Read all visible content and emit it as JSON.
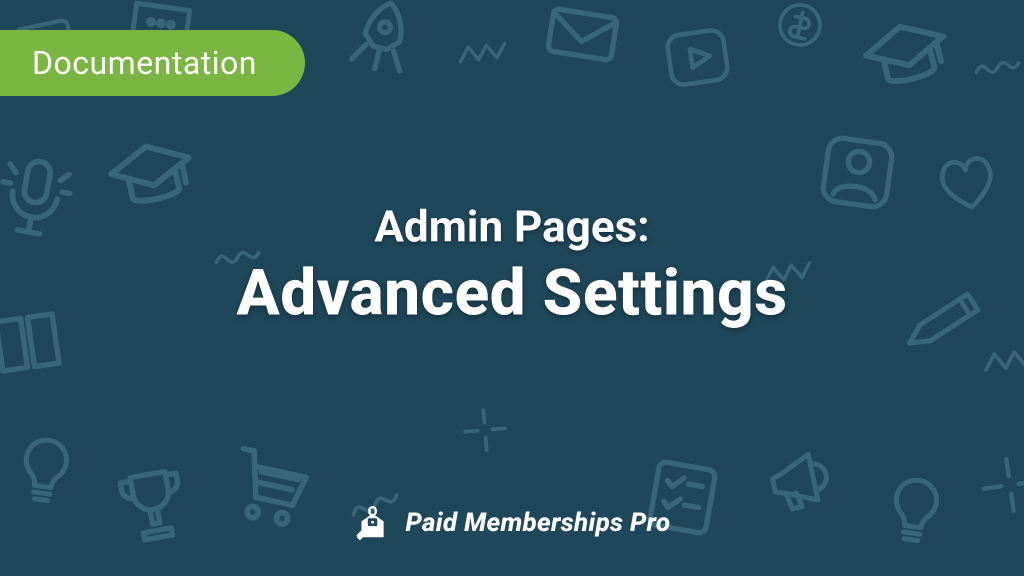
{
  "badge": {
    "label": "Documentation"
  },
  "title": {
    "line1": "Admin Pages:",
    "line2": "Advanced Settings"
  },
  "brand": {
    "name": "Paid Memberships Pro"
  },
  "colors": {
    "bg": "#1e4759",
    "badge": "#7bb642",
    "doodle": "#3b6a7c",
    "text": "#ffffff"
  }
}
